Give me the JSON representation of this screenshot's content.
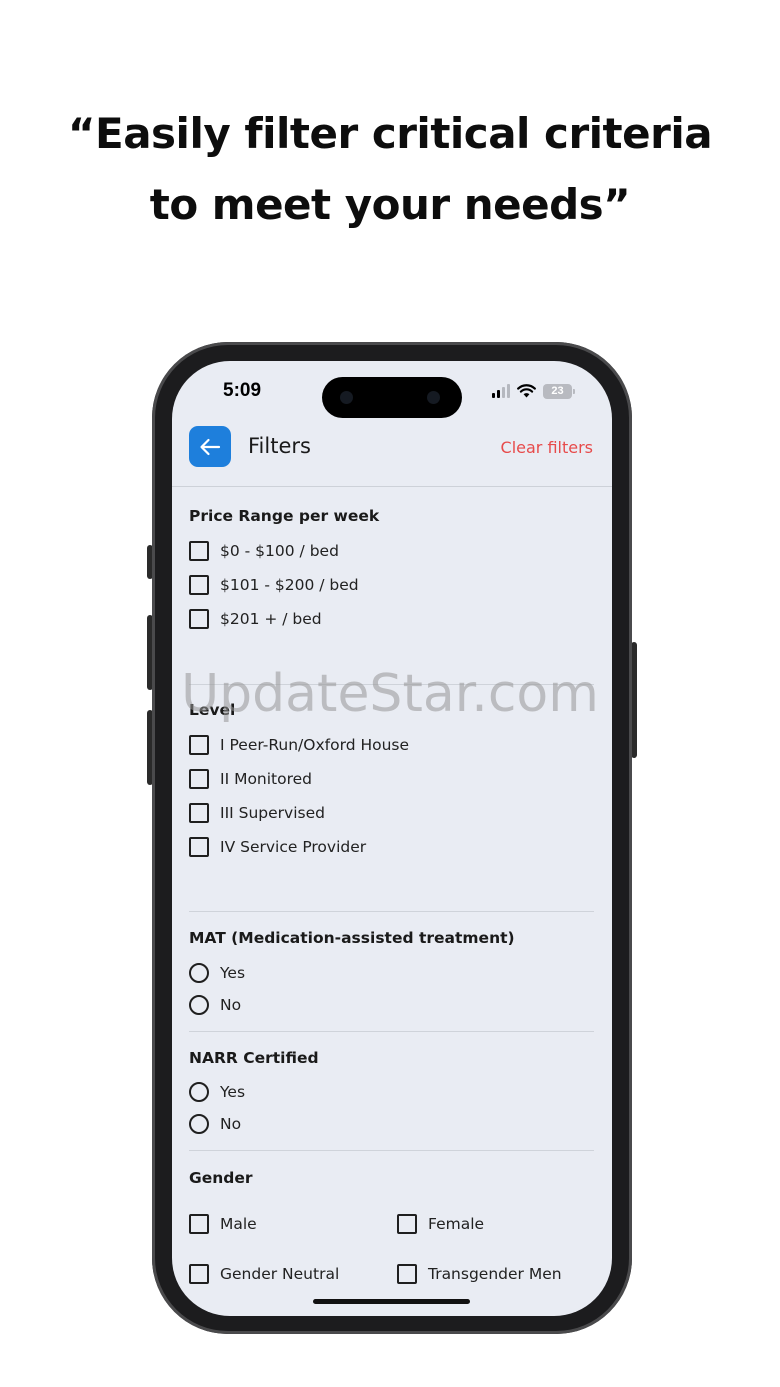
{
  "headline": {
    "line1": "“Easily filter critical criteria",
    "line2": "to meet your needs”"
  },
  "status_bar": {
    "time": "5:09",
    "battery": "23"
  },
  "header": {
    "back_icon": "arrow-left-icon",
    "title": "Filters",
    "clear_label": "Clear filters"
  },
  "colors": {
    "accent": "#1e7fdc",
    "clear": "#e74b4b",
    "screen_bg": "#e9ecf3"
  },
  "sections": {
    "price": {
      "title": "Price Range per week",
      "options": [
        "$0 - $100 / bed",
        "$101 - $200 / bed",
        "$201 + / bed"
      ]
    },
    "level": {
      "title": "Level",
      "options": [
        "I Peer-Run/Oxford House",
        "II Monitored",
        "III Supervised",
        "IV Service Provider"
      ]
    },
    "mat": {
      "title": "MAT (Medication-assisted treatment)",
      "options": [
        "Yes",
        "No"
      ]
    },
    "narr": {
      "title": "NARR Certified",
      "options": [
        "Yes",
        "No"
      ]
    },
    "gender": {
      "title": "Gender",
      "options": [
        "Male",
        "Female",
        "Gender Neutral",
        "Transgender Men"
      ]
    }
  },
  "watermark": "UpdateStar.com"
}
